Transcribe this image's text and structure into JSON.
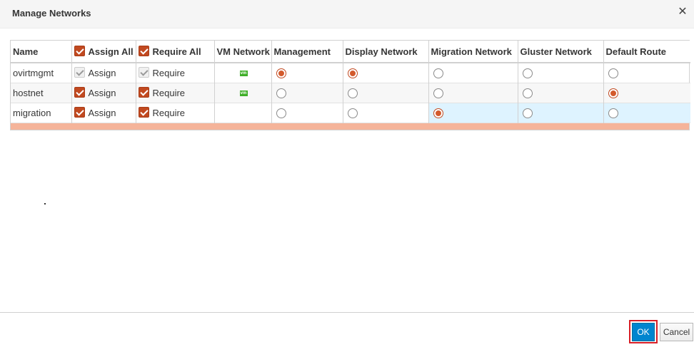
{
  "dialog": {
    "title": "Manage Networks"
  },
  "columns": {
    "name": "Name",
    "assign_all": "Assign All",
    "require_all": "Require All",
    "vm_network": "VM Network",
    "management": "Management",
    "display_network": "Display Network",
    "migration_network": "Migration Network",
    "gluster_network": "Gluster Network",
    "default_route": "Default Route"
  },
  "rows": [
    {
      "name": "ovirtmgmt",
      "assign": "Assign",
      "require": "Require",
      "vm_icon": "vm"
    },
    {
      "name": "hostnet",
      "assign": "Assign",
      "require": "Require",
      "vm_icon": "vm"
    },
    {
      "name": "migration",
      "assign": "Assign",
      "require": "Require"
    }
  ],
  "footer": {
    "ok_label": "OK",
    "cancel_label": "Cancel"
  },
  "icons": {
    "close": "close-icon",
    "vm": "vm-network-icon"
  },
  "colors": {
    "accent": "#c14920",
    "primary_button": "#0085cf",
    "highlight": "#d81e26"
  }
}
